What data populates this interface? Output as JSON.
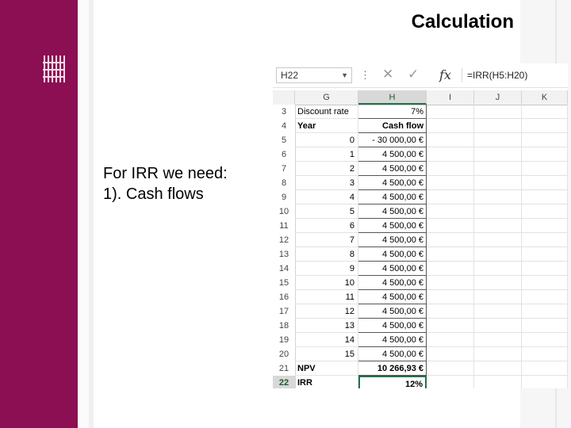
{
  "slide": {
    "title": "Calculation",
    "bullets": [
      "For IRR we need:",
      "1). Cash flows"
    ]
  },
  "excel": {
    "name_box": "H22",
    "formula": "=IRR(H5:H20)",
    "columns": [
      "G",
      "H",
      "I",
      "J",
      "K"
    ],
    "rows": [
      {
        "n": "3",
        "g": "Discount rate",
        "h": "7%"
      },
      {
        "n": "4",
        "g": "Year",
        "h": "Cash flow"
      },
      {
        "n": "5",
        "g": "0",
        "h": "- 30 000,00 €"
      },
      {
        "n": "6",
        "g": "1",
        "h": "4 500,00 €"
      },
      {
        "n": "7",
        "g": "2",
        "h": "4 500,00 €"
      },
      {
        "n": "8",
        "g": "3",
        "h": "4 500,00 €"
      },
      {
        "n": "9",
        "g": "4",
        "h": "4 500,00 €"
      },
      {
        "n": "10",
        "g": "5",
        "h": "4 500,00 €"
      },
      {
        "n": "11",
        "g": "6",
        "h": "4 500,00 €"
      },
      {
        "n": "12",
        "g": "7",
        "h": "4 500,00 €"
      },
      {
        "n": "13",
        "g": "8",
        "h": "4 500,00 €"
      },
      {
        "n": "14",
        "g": "9",
        "h": "4 500,00 €"
      },
      {
        "n": "15",
        "g": "10",
        "h": "4 500,00 €"
      },
      {
        "n": "16",
        "g": "11",
        "h": "4 500,00 €"
      },
      {
        "n": "17",
        "g": "12",
        "h": "4 500,00 €"
      },
      {
        "n": "18",
        "g": "13",
        "h": "4 500,00 €"
      },
      {
        "n": "19",
        "g": "14",
        "h": "4 500,00 €"
      },
      {
        "n": "20",
        "g": "15",
        "h": "4 500,00 €"
      },
      {
        "n": "21",
        "g": "NPV",
        "h": "10 266,93 €"
      },
      {
        "n": "22",
        "g": "IRR",
        "h": "12%"
      }
    ]
  },
  "icons": {
    "logo": "university-logo-icon",
    "cancel": "cancel-x-icon",
    "enter": "check-icon",
    "function": "fx-icon",
    "dropdown": "chevron-down-icon"
  },
  "colors": {
    "brand": "#8b0f52",
    "excel_green": "#217346"
  }
}
